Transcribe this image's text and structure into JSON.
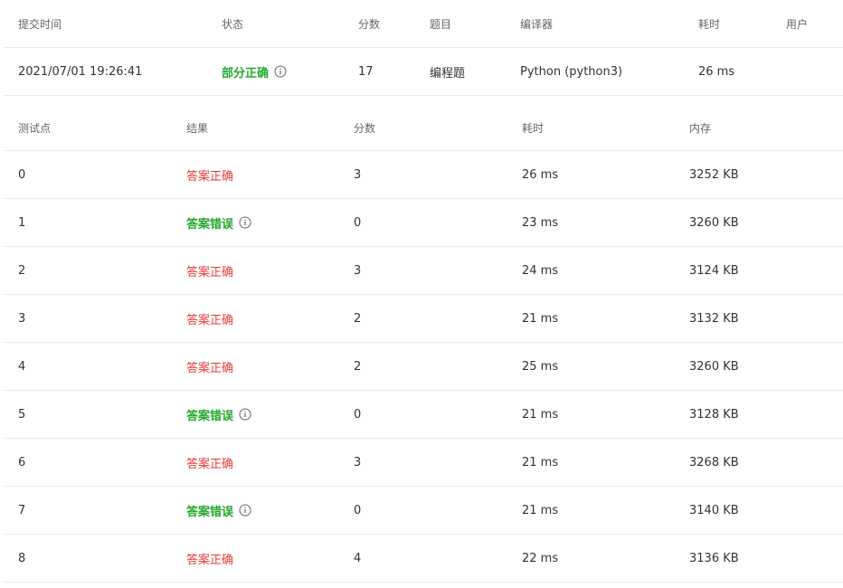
{
  "submission_table": {
    "headers": {
      "submit_time": "提交时间",
      "status": "状态",
      "score": "分数",
      "problem": "题目",
      "compiler": "编译器",
      "time": "耗时",
      "user": "用户"
    },
    "row": {
      "submit_time": "2021/07/01 19:26:41",
      "status": "部分正确",
      "score": "17",
      "problem": "编程题",
      "compiler": "Python (python3)",
      "time": "26 ms",
      "user": ""
    }
  },
  "test_table": {
    "headers": {
      "case": "测试点",
      "result": "结果",
      "score": "分数",
      "time": "耗时",
      "memory": "内存"
    },
    "rows": [
      {
        "case": "0",
        "result": "答案正确",
        "type": "ok",
        "score": "3",
        "time": "26 ms",
        "memory": "3252 KB"
      },
      {
        "case": "1",
        "result": "答案错误",
        "type": "bad",
        "score": "0",
        "time": "23 ms",
        "memory": "3260 KB"
      },
      {
        "case": "2",
        "result": "答案正确",
        "type": "ok",
        "score": "3",
        "time": "24 ms",
        "memory": "3124 KB"
      },
      {
        "case": "3",
        "result": "答案正确",
        "type": "ok",
        "score": "2",
        "time": "21 ms",
        "memory": "3132 KB"
      },
      {
        "case": "4",
        "result": "答案正确",
        "type": "ok",
        "score": "2",
        "time": "25 ms",
        "memory": "3260 KB"
      },
      {
        "case": "5",
        "result": "答案错误",
        "type": "bad",
        "score": "0",
        "time": "21 ms",
        "memory": "3128 KB"
      },
      {
        "case": "6",
        "result": "答案正确",
        "type": "ok",
        "score": "3",
        "time": "21 ms",
        "memory": "3268 KB"
      },
      {
        "case": "7",
        "result": "答案错误",
        "type": "bad",
        "score": "0",
        "time": "21 ms",
        "memory": "3140 KB"
      },
      {
        "case": "8",
        "result": "答案正确",
        "type": "ok",
        "score": "4",
        "time": "22 ms",
        "memory": "3136 KB"
      }
    ]
  },
  "colors": {
    "correct": "#e53935",
    "wrong": "#25a82e",
    "partial": "#25a82e",
    "border": "#ebebeb"
  },
  "icons": {
    "status_info": "info-icon",
    "wrong_info": "info-icon"
  }
}
